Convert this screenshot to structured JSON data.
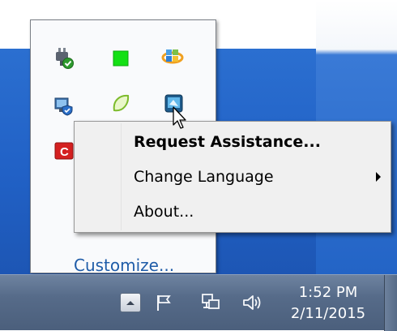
{
  "tray_popup": {
    "customize_link": "Customize..."
  },
  "context_menu": {
    "items": [
      {
        "label": "Request Assistance...",
        "default": true
      },
      {
        "label": "Change Language",
        "has_submenu": true
      },
      {
        "label": "About..."
      }
    ]
  },
  "taskbar": {
    "clock": {
      "time": "1:52 PM",
      "date": "2/11/2015"
    }
  },
  "colors": {
    "desktop_blue": "#2161c6",
    "menu_background": "#f0f0f0",
    "taskbar": "#566b89"
  }
}
